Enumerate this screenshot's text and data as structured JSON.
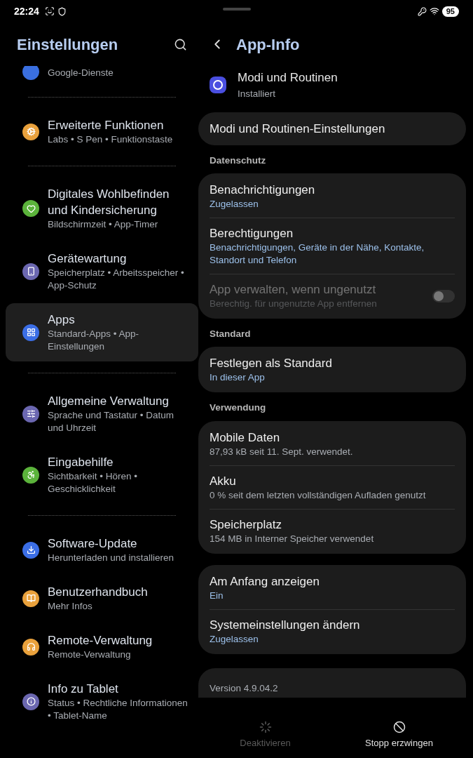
{
  "status_bar": {
    "time": "22:24",
    "battery": "95"
  },
  "sidebar": {
    "title": "Einstellungen",
    "groups": [
      {
        "items": [
          {
            "subtitle": "Google-Dienste",
            "color": "#3a6fe0",
            "selected": false
          }
        ]
      },
      {
        "items": [
          {
            "title": "Erweiterte Funktionen",
            "subtitle": "Labs • S Pen • Funktionstaste",
            "color": "#e9a13c",
            "selected": false
          }
        ]
      },
      {
        "items": [
          {
            "title": "Digitales Wohlbefinden und Kindersicherung",
            "subtitle": "Bildschirmzeit • App-Timer",
            "color": "#5bb33b",
            "selected": false
          },
          {
            "title": "Gerätewartung",
            "subtitle": "Speicherplatz • Arbeitsspeicher • App-Schutz",
            "color": "#6b67b0",
            "selected": false
          },
          {
            "title": "Apps",
            "subtitle": "Standard-Apps • App-Einstellungen",
            "color": "#3b6ee6",
            "selected": true
          }
        ]
      },
      {
        "items": [
          {
            "title": "Allgemeine Verwaltung",
            "subtitle": "Sprache und Tastatur • Datum und Uhrzeit",
            "color": "#6b67b0",
            "selected": false
          },
          {
            "title": "Eingabehilfe",
            "subtitle": "Sichtbarkeit • Hören • Geschicklichkeit",
            "color": "#5bb33b",
            "selected": false
          }
        ]
      },
      {
        "items": [
          {
            "title": "Software-Update",
            "subtitle": "Herunterladen und installieren",
            "color": "#3b6ee6",
            "selected": false
          },
          {
            "title": "Benutzerhandbuch",
            "subtitle": "Mehr Infos",
            "color": "#e9a13c",
            "selected": false
          },
          {
            "title": "Remote-Verwaltung",
            "subtitle": "Remote-Verwaltung",
            "color": "#e9a13c",
            "selected": false
          },
          {
            "title": "Info zu Tablet",
            "subtitle": "Status • Rechtliche Informationen • Tablet-Name",
            "color": "#6b67b0",
            "selected": false
          }
        ]
      }
    ]
  },
  "detail": {
    "title": "App-Info",
    "app": {
      "name": "Modi und Routinen",
      "status": "Installiert"
    },
    "sections": [
      {
        "rows": [
          {
            "kind": "plain",
            "title": "Modi und Routinen-Einstellungen",
            "disabled": false
          }
        ]
      },
      {
        "header": "Datenschutz",
        "rows": [
          {
            "kind": "link",
            "title": "Benachrichtigungen",
            "subtitle": "Zugelassen",
            "disabled": false
          },
          {
            "kind": "link",
            "title": "Berechtigungen",
            "subtitle": "Benachrichtigungen, Geräte in der Nähe, Kontakte, Standort und Telefon",
            "disabled": false
          },
          {
            "kind": "toggle",
            "title": "App verwalten, wenn ungenutzt",
            "subtitle": "Berechtig. für ungenutzte App entfernen",
            "disabled": true,
            "on": false
          }
        ]
      },
      {
        "header": "Standard",
        "rows": [
          {
            "kind": "link",
            "title": "Festlegen als Standard",
            "subtitle": "In dieser App",
            "disabled": false
          }
        ]
      },
      {
        "header": "Verwendung",
        "rows": [
          {
            "kind": "info",
            "title": "Mobile Daten",
            "subtitle": "87,93 kB seit 11. Sept. verwendet.",
            "disabled": false
          },
          {
            "kind": "info",
            "title": "Akku",
            "subtitle": "0 % seit dem letzten vollständigen Aufladen genutzt",
            "disabled": false
          },
          {
            "kind": "info",
            "title": "Speicherplatz",
            "subtitle": "154 MB in Interner Speicher verwendet",
            "disabled": false
          }
        ]
      },
      {
        "rows": [
          {
            "kind": "link",
            "title": "Am Anfang anzeigen",
            "subtitle": "Ein",
            "disabled": false
          },
          {
            "kind": "link",
            "title": "Systemeinstellungen ändern",
            "subtitle": "Zugelassen",
            "disabled": false
          }
        ]
      }
    ],
    "version": "Version 4.9.04.2"
  },
  "bottom_bar": [
    {
      "label": "Deaktivieren",
      "disabled": true
    },
    {
      "label": "Stopp erzwingen",
      "disabled": false
    }
  ]
}
